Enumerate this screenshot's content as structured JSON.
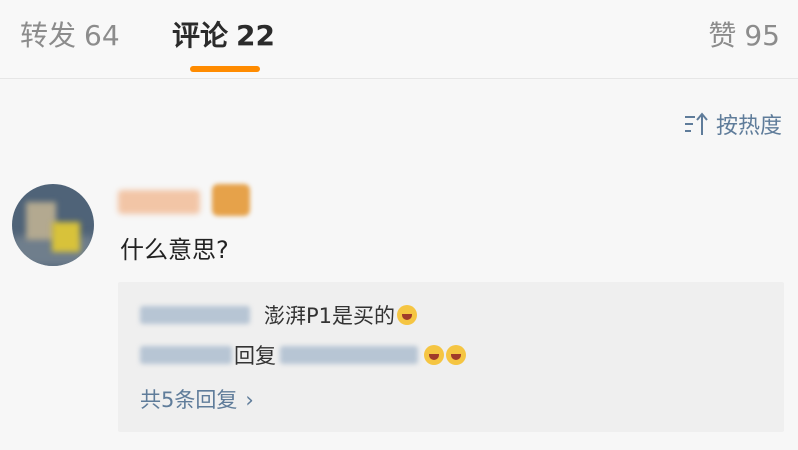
{
  "tabs": {
    "repost": {
      "label": "转发",
      "count": "64"
    },
    "comments": {
      "label": "评论",
      "count": "22"
    },
    "likes": {
      "label": "赞",
      "count": "95"
    }
  },
  "accent_color": "#ff8b00",
  "link_color": "#5f7c9a",
  "sort": {
    "label": "按热度",
    "icon": "sort-icon"
  },
  "comment": {
    "text": "什么意思?"
  },
  "replies": {
    "row1_text": "澎湃P1是买的",
    "row2_text": "回复",
    "expand_label": "共5条回复",
    "expand_icon": "chevron-right-icon"
  }
}
